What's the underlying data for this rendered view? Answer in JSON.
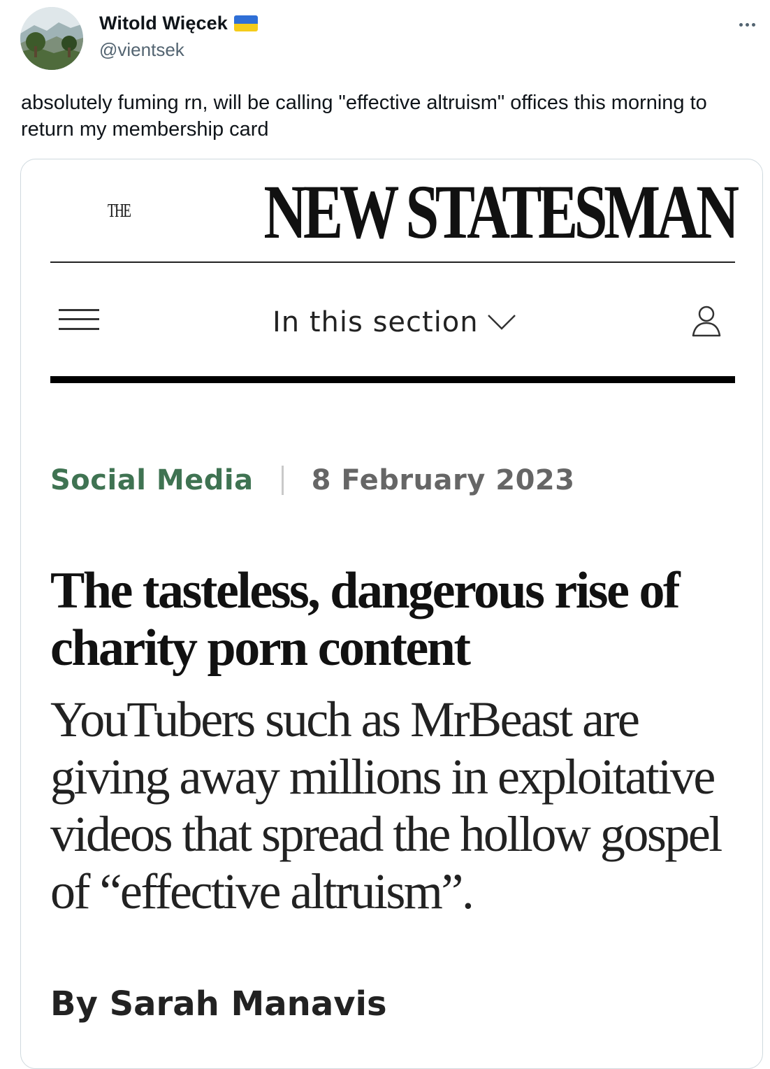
{
  "tweet": {
    "author": {
      "display_name": "Witold Więcek",
      "handle": "@vientsek",
      "flag": {
        "top_color": "#2f6fd6",
        "bottom_color": "#f5cc1b"
      }
    },
    "text": "absolutely fuming rn, will be calling \"effective altruism\" offices this morning to return my membership card",
    "more_icon": "ellipsis-icon"
  },
  "article_card": {
    "publication_the": "THE",
    "publication_name": "NEW STATESMAN",
    "nav": {
      "section_label": "In this section",
      "menu_icon": "hamburger-icon",
      "chevron_icon": "chevron-down-icon",
      "account_icon": "user-icon"
    },
    "category": "Social Media",
    "date": "8 February 2023",
    "headline": "The tasteless, dangerous rise of charity porn content",
    "standfirst": "YouTubers such as MrBeast are giving away millions in exploitative videos that spread the hollow gospel of “effective altruism”.",
    "byline": "By Sarah Manavis",
    "colors": {
      "category": "#3f7352",
      "date": "#666666"
    }
  }
}
